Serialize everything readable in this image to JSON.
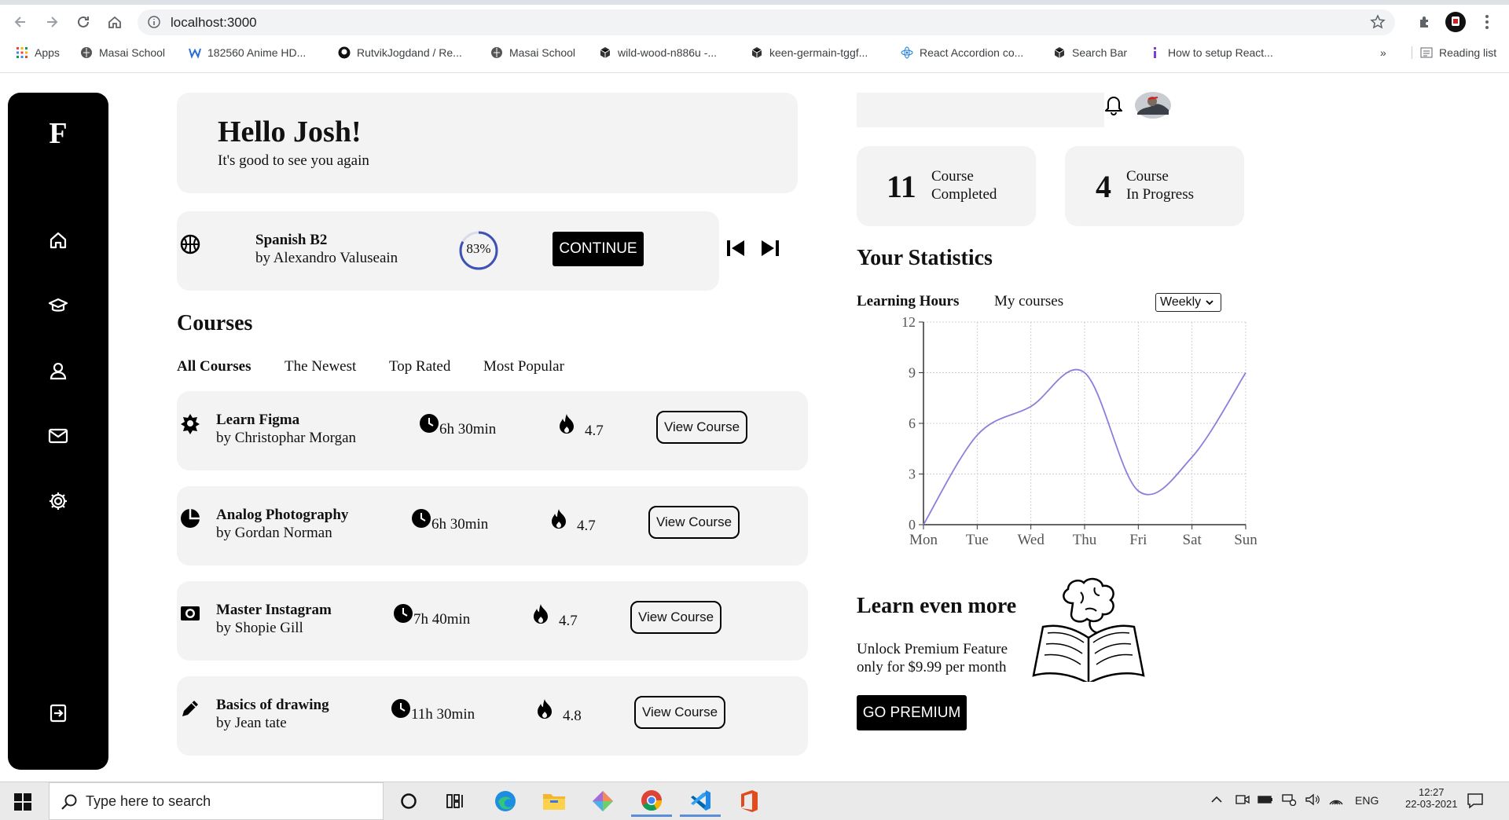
{
  "browser": {
    "url": "localhost:3000",
    "bookmarks": [
      {
        "label": "Apps",
        "icon": "apps-grid-icon"
      },
      {
        "label": "Masai School",
        "icon": "globe-icon"
      },
      {
        "label": "182560 Anime HD...",
        "icon": "w-logo-icon"
      },
      {
        "label": "RutvikJogdand / Re...",
        "icon": "github-icon"
      },
      {
        "label": "Masai School",
        "icon": "globe-icon"
      },
      {
        "label": "wild-wood-n886u -...",
        "icon": "cube-icon"
      },
      {
        "label": "keen-germain-tggf...",
        "icon": "cube-icon"
      },
      {
        "label": "React Accordion co...",
        "icon": "react-icon"
      },
      {
        "label": "Search Bar",
        "icon": "cube-icon"
      },
      {
        "label": "How to setup React...",
        "icon": "tip-icon"
      }
    ],
    "overflow": "»",
    "reading_list": "Reading list"
  },
  "sidebar": {
    "logo": "F",
    "items": [
      "home-icon",
      "graduation-cap-icon",
      "user-icon",
      "mail-icon",
      "settings-icon"
    ],
    "logout": "logout-icon"
  },
  "hello": {
    "title": "Hello Josh!",
    "subtitle": "It's good to see you again"
  },
  "current_course": {
    "title": "Spanish B2",
    "author": "by Alexandro Valuseain",
    "progress_label": "83%",
    "progress": 0.83,
    "continue_label": "CONTINUE"
  },
  "courses": {
    "heading": "Courses",
    "tabs": [
      "All Courses",
      "The Newest",
      "Top Rated",
      "Most Popular"
    ],
    "active_tab": 0,
    "view_label": "View Course",
    "list": [
      {
        "title": "Learn Figma",
        "author": "by Christophar Morgan",
        "duration": "6h 30min",
        "rating": "4.7",
        "icon": "gear-star-icon"
      },
      {
        "title": "Analog Photography",
        "author": "by Gordan Norman",
        "duration": "6h 30min",
        "rating": "4.7",
        "icon": "pie-chart-icon"
      },
      {
        "title": "Master Instagram",
        "author": "by Shopie Gill",
        "duration": "7h 40min",
        "rating": "4.7",
        "icon": "camera-icon"
      },
      {
        "title": "Basics of drawing",
        "author": "by Jean tate",
        "duration": "11h 30min",
        "rating": "4.8",
        "icon": "pencil-icon"
      }
    ]
  },
  "summary": {
    "completed_count": "11",
    "completed_line1": "Course",
    "completed_line2": "Completed",
    "progress_count": "4",
    "progress_line1": "Course",
    "progress_line2": "In Progress"
  },
  "statistics": {
    "heading": "Your Statistics",
    "tab_active": "Learning Hours",
    "tab_other": "My courses",
    "period": "Weekly"
  },
  "chart_data": {
    "type": "line",
    "categories": [
      "Mon",
      "Tue",
      "Wed",
      "Thu",
      "Fri",
      "Sat",
      "Sun"
    ],
    "series": [
      {
        "values": [
          0,
          5.3,
          7,
          9,
          2,
          4,
          9
        ]
      }
    ],
    "ylim": [
      0,
      12
    ],
    "yticks": [
      0,
      3,
      6,
      9,
      12
    ],
    "grid": true,
    "color": "#8a7fdc"
  },
  "premium": {
    "heading": "Learn even more",
    "line1": "Unlock Premium Feature",
    "line2": "only for $9.99 per month",
    "button": "GO PREMIUM"
  },
  "taskbar": {
    "search_placeholder": "Type here to search",
    "lang": "ENG",
    "time": "12:27",
    "date": "22-03-2021"
  }
}
